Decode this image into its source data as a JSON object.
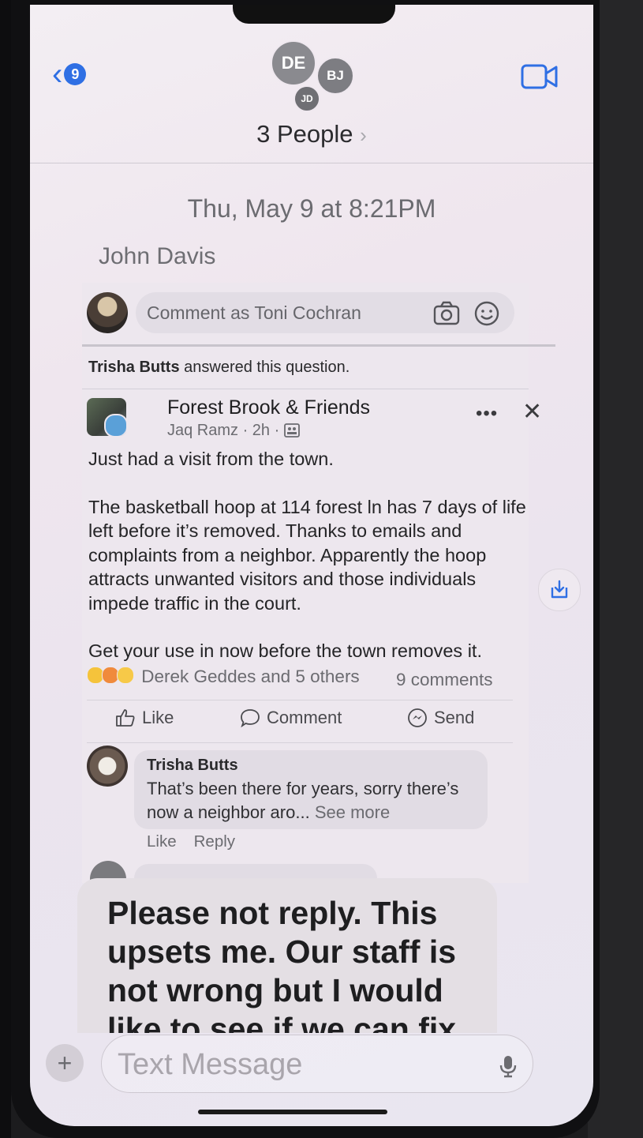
{
  "header": {
    "back_count": "9",
    "avatars": [
      "DE",
      "BJ",
      "JD"
    ],
    "title": "3 People",
    "title_chevron": "›"
  },
  "timestamp": "Thu, May 9 at 8:21PM",
  "sender_name": "John Davis",
  "screenshot": {
    "comment_placeholder": "Comment as Toni Cochran",
    "answered_name": "Trisha Butts",
    "answered_text": " answered this question.",
    "group_name": "Forest Brook & Friends",
    "poster_line": "Jaq Ramz · 2h ·",
    "post_paragraphs": [
      "Just had a visit from the town.",
      "The basketball hoop at 114 forest ln has 7 days of life left before it’s removed.   Thanks to emails and complaints from a neighbor. Apparently the hoop attracts unwanted visitors and those individuals impede traffic in the court.",
      "Get your use in now before the town removes it."
    ],
    "reactions_text": "Derek Geddes and 5 others",
    "comments_count": "9 comments",
    "actions": {
      "like": "Like",
      "comment": "Comment",
      "send": "Send"
    },
    "comment": {
      "name": "Trisha Butts",
      "text": "That’s been there for years, sorry there’s now a neighbor aro... ",
      "see_more": "See more",
      "like": "Like",
      "reply": "Reply"
    }
  },
  "message_text": "Please not reply.   This upsets me.  Our staff is not wrong but I would like to see if we can fix",
  "input": {
    "placeholder": "Text Message",
    "plus": "+"
  },
  "colors": {
    "accent": "#2f6fe4",
    "bubble_gray": "#e4dfe4"
  }
}
